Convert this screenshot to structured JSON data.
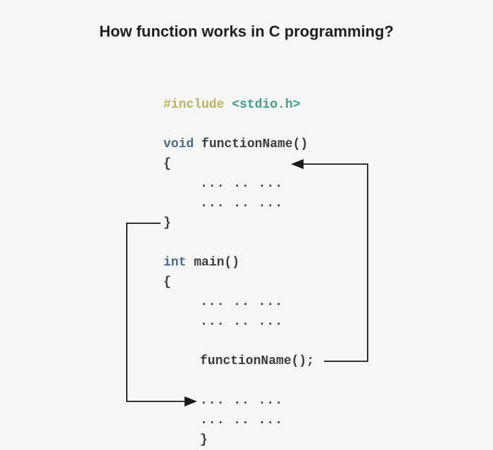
{
  "title": "How function works in C programming?",
  "code": {
    "include_kw": "#include",
    "header": "<stdio.h>",
    "void_kw": "void",
    "func_name": "functionName()",
    "open_brace": "{",
    "close_brace": "}",
    "dots": "... .. ...",
    "int_kw": "int",
    "main_name": "main()",
    "call": "functionName();"
  }
}
